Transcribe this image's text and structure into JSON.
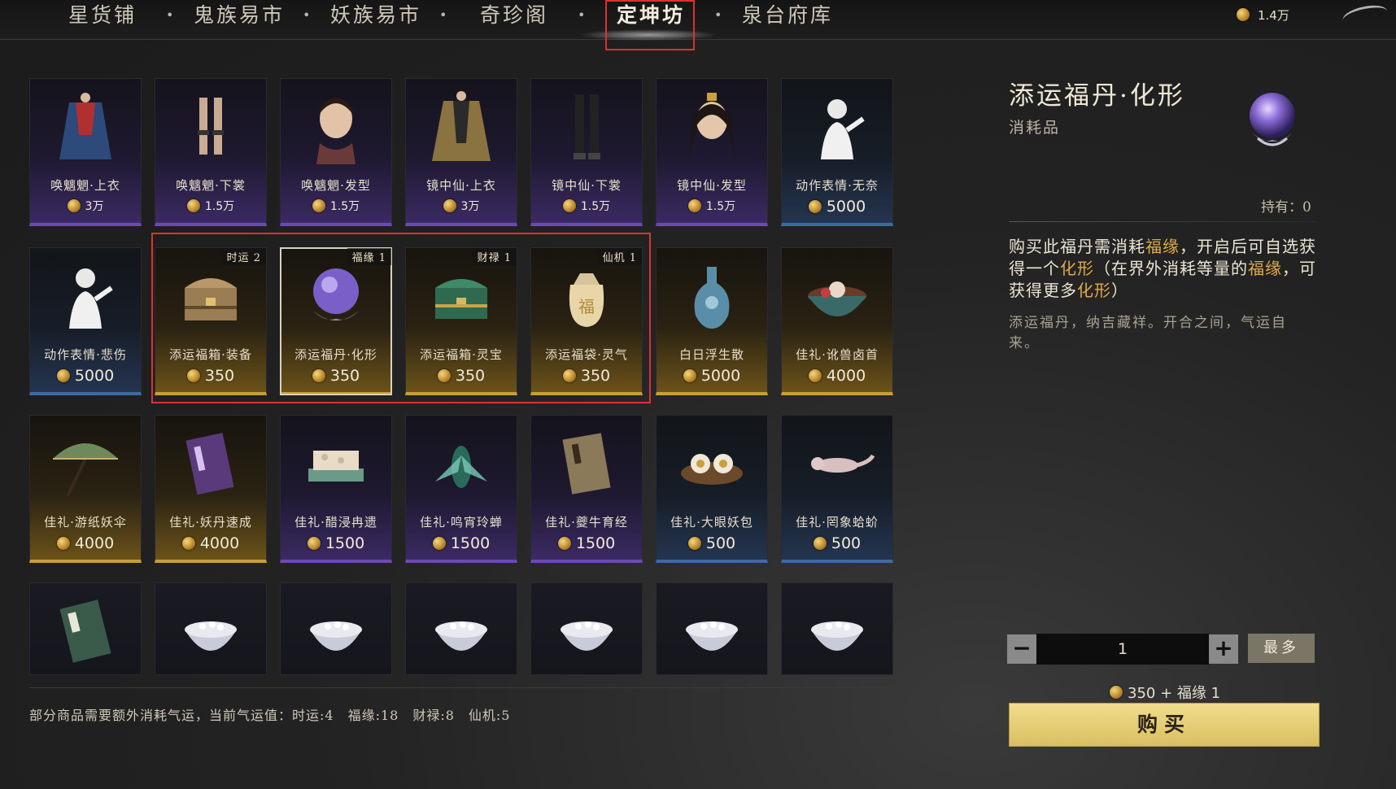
{
  "nav": {
    "tabs": [
      "星货铺",
      "鬼族易市",
      "妖族易市",
      "奇珍阁",
      "定坤坊",
      "泉台府库"
    ],
    "active_index": 4,
    "currency_amount": "1.4万"
  },
  "items": [
    {
      "name": "唤魑魍·上衣",
      "price": "3万",
      "tier": "purple",
      "art": "robe"
    },
    {
      "name": "唤魑魍·下裳",
      "price": "1.5万",
      "tier": "purple",
      "art": "legs"
    },
    {
      "name": "唤魑魍·发型",
      "price": "1.5万",
      "tier": "purple",
      "art": "head"
    },
    {
      "name": "镜中仙·上衣",
      "price": "3万",
      "tier": "purple",
      "art": "robe2"
    },
    {
      "name": "镜中仙·下裳",
      "price": "1.5万",
      "tier": "purple",
      "art": "legs2"
    },
    {
      "name": "镜中仙·发型",
      "price": "1.5万",
      "tier": "purple",
      "art": "head2"
    },
    {
      "name": "动作表情·无奈",
      "price": "5000",
      "tier": "blue",
      "art": "figure"
    },
    {
      "name": "动作表情·悲伤",
      "price": "5000",
      "tier": "blue",
      "art": "figure"
    },
    {
      "name": "添运福箱·装备",
      "price": "350",
      "tier": "gold",
      "art": "chest",
      "tag": "时运 2"
    },
    {
      "name": "添运福丹·化形",
      "price": "350",
      "tier": "gold",
      "art": "orb",
      "tag": "福缘 1",
      "selected": true
    },
    {
      "name": "添运福箱·灵宝",
      "price": "350",
      "tier": "gold",
      "art": "chest2",
      "tag": "财禄 1"
    },
    {
      "name": "添运福袋·灵气",
      "price": "350",
      "tier": "gold",
      "art": "bag",
      "tag": "仙机 1"
    },
    {
      "name": "白日浮生散",
      "price": "5000",
      "tier": "gold",
      "art": "vase"
    },
    {
      "name": "佳礼·讹兽卤首",
      "price": "4000",
      "tier": "gold",
      "art": "bowl"
    },
    {
      "name": "佳礼·游纸妖伞",
      "price": "4000",
      "tier": "gold",
      "art": "umbrella"
    },
    {
      "name": "佳礼·妖丹速成",
      "price": "4000",
      "tier": "gold",
      "art": "book"
    },
    {
      "name": "佳礼·醋浸冉遗",
      "price": "1500",
      "tier": "purple",
      "art": "tray"
    },
    {
      "name": "佳礼·鸣宵玲蝉",
      "price": "1500",
      "tier": "purple",
      "art": "cicada"
    },
    {
      "name": "佳礼·夔牛育经",
      "price": "1500",
      "tier": "purple",
      "art": "book2"
    },
    {
      "name": "佳礼·大眼妖包",
      "price": "500",
      "tier": "blue",
      "art": "eggs"
    },
    {
      "name": "佳礼·罔象蛤蚧",
      "price": "500",
      "tier": "blue",
      "art": "lizard"
    },
    {
      "name": "",
      "price": "",
      "tier": "none",
      "art": "book3"
    },
    {
      "name": "",
      "price": "",
      "tier": "none",
      "art": "rice"
    },
    {
      "name": "",
      "price": "",
      "tier": "none",
      "art": "rice"
    },
    {
      "name": "",
      "price": "",
      "tier": "none",
      "art": "rice"
    },
    {
      "name": "",
      "price": "",
      "tier": "none",
      "art": "rice"
    },
    {
      "name": "",
      "price": "",
      "tier": "none",
      "art": "rice"
    },
    {
      "name": "",
      "price": "",
      "tier": "none",
      "art": "rice"
    }
  ],
  "footnote": "部分商品需要额外消耗气运，当前气运值：时运:4　福缘:18　财禄:8　仙机:5",
  "detail": {
    "title": "添运福丹·化形",
    "subtitle": "消耗品",
    "owned": "持有：0",
    "desc_parts": [
      "购买此福丹需消耗",
      "福缘",
      "，开启后可自选获得一个",
      "化形",
      "（在界外消耗等量的",
      "福缘",
      "，可获得更多",
      "化形",
      "）"
    ],
    "flavor": "添运福丹，纳吉藏祥。开合之间，气运自来。",
    "quantity": "1",
    "max_label": "最多",
    "cost_text": "350 + 福缘 1",
    "buy_label": "购买"
  },
  "colors": {
    "accent_gold": "#e2a94a",
    "highlight_red": "#e03030",
    "purple_tier": "#6c49b5",
    "gold_tier": "#c99e3a",
    "blue_tier": "#3e6aa3"
  }
}
